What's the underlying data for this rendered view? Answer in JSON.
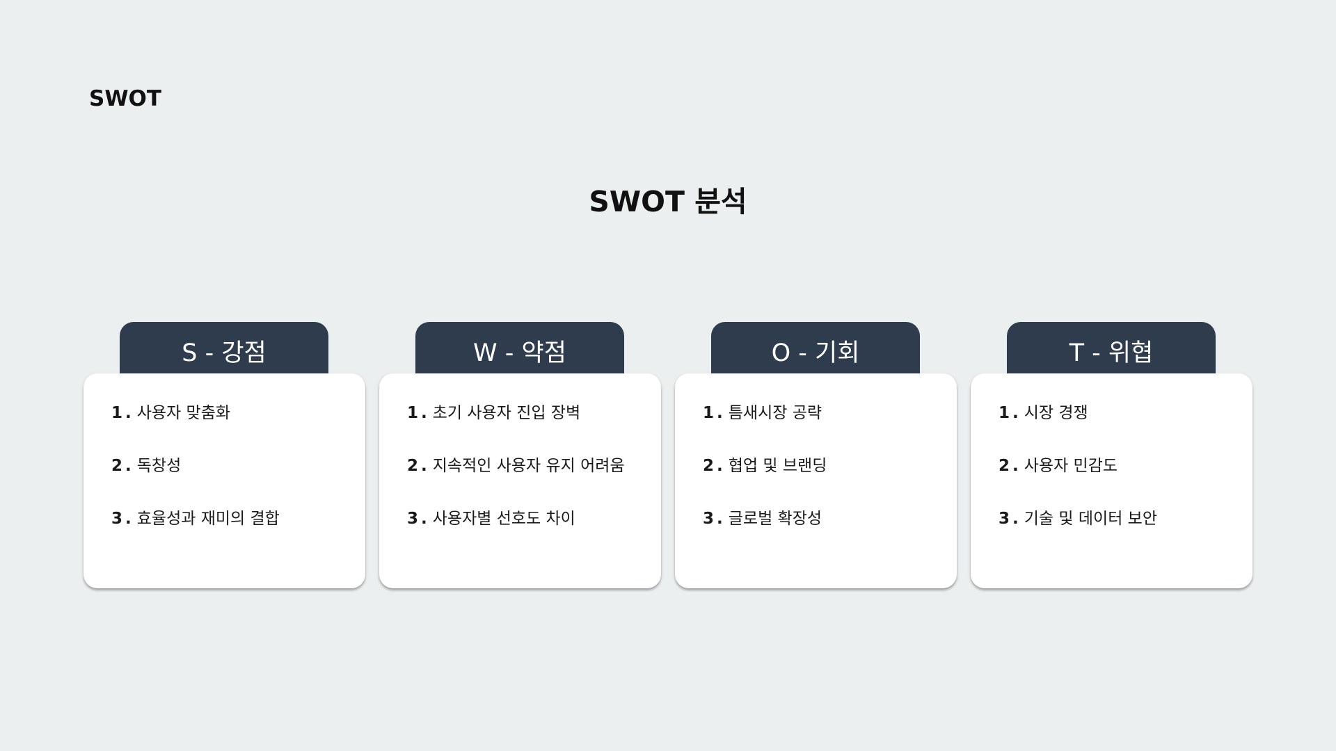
{
  "header": {
    "corner_label": "SWOT",
    "title": "SWOT 분석"
  },
  "cards": [
    {
      "tab_label": "S - 강점",
      "items": [
        {
          "num": "1",
          "text": "사용자 맞춤화"
        },
        {
          "num": "2",
          "text": "독창성"
        },
        {
          "num": "3",
          "text": "효율성과 재미의 결합"
        }
      ]
    },
    {
      "tab_label": "W - 약점",
      "items": [
        {
          "num": "1",
          "text": "초기 사용자 진입 장벽"
        },
        {
          "num": "2",
          "text": "지속적인 사용자 유지 어려움"
        },
        {
          "num": "3",
          "text": "사용자별 선호도 차이"
        }
      ]
    },
    {
      "tab_label": "O - 기회",
      "items": [
        {
          "num": "1",
          "text": "틈새시장 공략"
        },
        {
          "num": "2",
          "text": "협업 및 브랜딩"
        },
        {
          "num": "3",
          "text": "글로벌 확장성"
        }
      ]
    },
    {
      "tab_label": "T - 위협",
      "items": [
        {
          "num": "1",
          "text": "시장 경쟁"
        },
        {
          "num": "2",
          "text": "사용자 민감도"
        },
        {
          "num": "3",
          "text": "기술 및 데이터 보안"
        }
      ]
    }
  ],
  "colors": {
    "background": "#ebeff0",
    "tab": "#2e3c4d",
    "card": "#ffffff"
  }
}
